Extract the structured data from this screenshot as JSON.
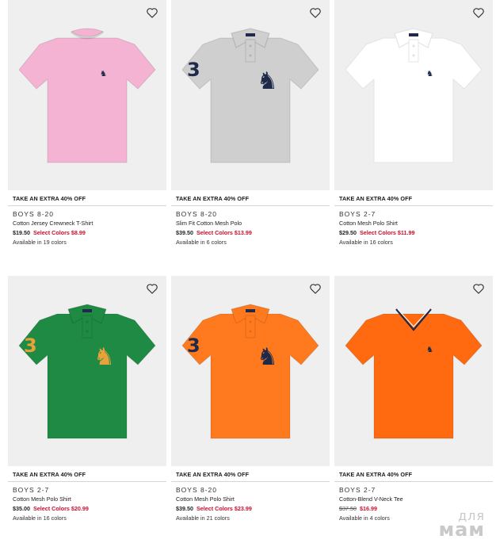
{
  "products": [
    {
      "promo": "TAKE AN EXTRA 40% OFF",
      "age": "BOYS 8-20",
      "name": "Cotton Jersey Crewneck T-Shirt",
      "original_price": "$19.50",
      "sale_label": "Select Colors $8.99",
      "availability": "Available in 19 colors",
      "shirt_color": "#f5b3d3",
      "style": "tee",
      "logo_color": "#1f2a4a"
    },
    {
      "promo": "TAKE AN EXTRA 40% OFF",
      "age": "BOYS 8-20",
      "name": "Slim Fit Cotton Mesh Polo",
      "original_price": "$39.50",
      "sale_label": "Select Colors $13.99",
      "availability": "Available in 6 colors",
      "shirt_color": "#cfcfcf",
      "style": "polo-big",
      "logo_color": "#1f2a4a"
    },
    {
      "promo": "TAKE AN EXTRA 40% OFF",
      "age": "BOYS 2-7",
      "name": "Cotton Mesh Polo Shirt",
      "original_price": "$29.50",
      "sale_label": "Select Colors $11.99",
      "availability": "Available in 16 colors",
      "shirt_color": "#ffffff",
      "style": "polo",
      "logo_color": "#1f2a4a"
    },
    {
      "promo": "TAKE AN EXTRA 40% OFF",
      "age": "BOYS 2-7",
      "name": "Cotton Mesh Polo Shirt",
      "original_price": "$35.00",
      "sale_label": "Select Colors $20.99",
      "availability": "Available in 16 colors",
      "shirt_color": "#1f8a43",
      "style": "polo-big",
      "logo_color": "#e8a23a"
    },
    {
      "promo": "TAKE AN EXTRA 40% OFF",
      "age": "BOYS 8-20",
      "name": "Cotton Mesh Polo Shirt",
      "original_price": "$39.50",
      "sale_label": "Select Colors $23.99",
      "availability": "Available in 21 colors",
      "shirt_color": "#ff7a1f",
      "style": "polo-big",
      "logo_color": "#1f2a4a"
    },
    {
      "promo": "TAKE AN EXTRA 40% OFF",
      "age": "BOYS 2-7",
      "name": "Cotton-Blend V-Neck Tee",
      "original_price": "$37.50",
      "sale_label": "$16.99",
      "availability": "Available in 4 colors",
      "shirt_color": "#ff6a10",
      "style": "vneck",
      "logo_color": "#1f2a4a",
      "strike_original": true
    }
  ],
  "watermark": {
    "line1": "для",
    "line2": "мам"
  },
  "icons": {
    "favorite": "heart-outline-icon"
  }
}
